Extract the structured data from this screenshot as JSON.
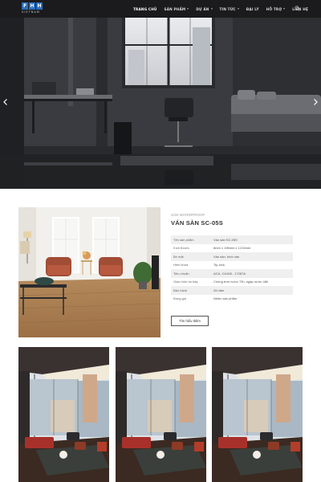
{
  "header": {
    "logo_letters": [
      "F",
      "H",
      "H"
    ],
    "logo_sub": "VIETNAM",
    "nav": [
      {
        "label": "TRANG CHỦ",
        "active": true,
        "dropdown": false
      },
      {
        "label": "SẢN PHẨM",
        "active": false,
        "dropdown": true
      },
      {
        "label": "DỰ ÁN",
        "active": false,
        "dropdown": true
      },
      {
        "label": "TIN TỨC",
        "active": false,
        "dropdown": true
      },
      {
        "label": "ĐẠI LÝ",
        "active": false,
        "dropdown": false
      },
      {
        "label": "HỖ TRỢ",
        "active": false,
        "dropdown": true
      },
      {
        "label": "LIÊN HỆ",
        "active": false,
        "dropdown": false
      }
    ],
    "search_icon": "search-icon"
  },
  "hero": {
    "prev_icon": "chevron-left-icon",
    "next_icon": "chevron-right-icon"
  },
  "product": {
    "category": "SÀN WATERPROOF",
    "title": "VÁN SÀN SC-05S",
    "specs": [
      {
        "label": "Tên sản phẩm",
        "value": "Ván sàn SC-05S"
      },
      {
        "label": "Kích thước",
        "value": "8mm x 196mm x 1215mm"
      },
      {
        "label": "Bề mặt",
        "value": "Vân sần, hình vân"
      },
      {
        "label": "Hèm khóa",
        "value": "Tip-lock"
      },
      {
        "label": "Tiêu chuẩn",
        "value": "ACA, CA108 - 17287A"
      },
      {
        "label": "Giao hình hồ bậy",
        "value": "Chống trơn nước 72h, ngập nước 48h"
      },
      {
        "label": "Bảo hành",
        "value": "25 năm"
      },
      {
        "label": "Đóng gói",
        "value": "Nhiều sản phẩm"
      }
    ],
    "cta_label": "Tìm hiểu thêm"
  },
  "colors": {
    "header_bg": "#1b1b1d",
    "logo_blue": "#2a6ebb",
    "floor_wood": "#a87c4f"
  }
}
